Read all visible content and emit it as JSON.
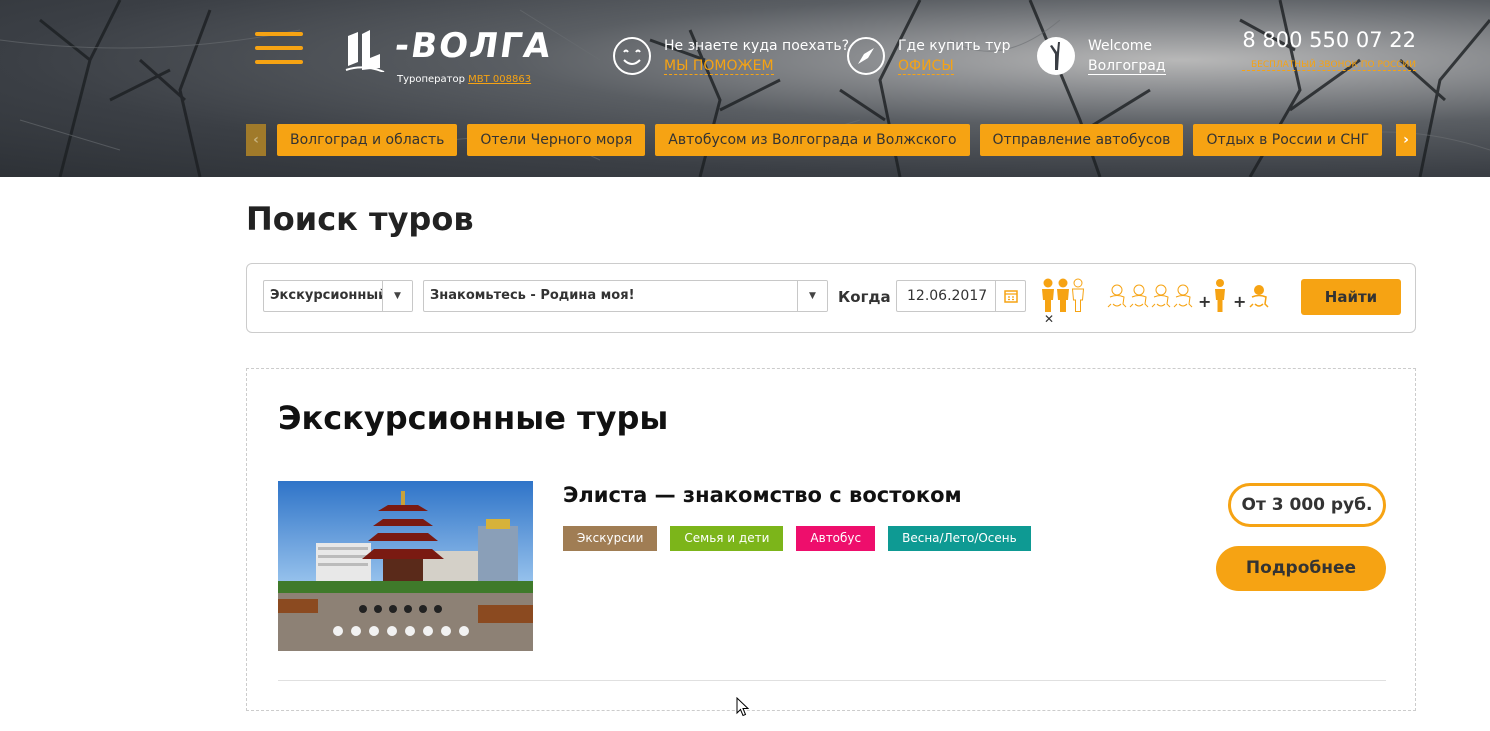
{
  "brand": {
    "logo_text": "В-ВОЛГА",
    "operator_prefix": "Туроператор",
    "operator_id": "МВТ 008863"
  },
  "header": {
    "help": {
      "line1": "Не знаете куда поехать?",
      "line2": "МЫ ПОМОЖЕМ",
      "icon": "smile-icon"
    },
    "offices": {
      "line1": "Где купить тур",
      "line2": "ОФИСЫ",
      "icon": "compass-icon"
    },
    "city": {
      "line1": "Welcome",
      "line2": "Волгоград",
      "icon": "monument-icon"
    },
    "phone": {
      "number": "8 800 550 07 22",
      "note": "БЕСПЛАТНЫЙ ЗВОНОК ПО РОССИИ"
    }
  },
  "categories": [
    "Волгоград и область",
    "Отели Черного моря",
    "Автобусом из Волгограда и Волжского",
    "Отправление автобусов",
    "Отдых в России и СНГ"
  ],
  "search": {
    "title": "Поиск туров",
    "type_value": "Экскурсионный.",
    "tour_value": "Знакомьтесь - Родина моя!",
    "when_label": "Когда",
    "date_value": "12.06.2017",
    "adults_selected": 2,
    "adults_max": 3,
    "children_slots": 4,
    "find_label": "Найти"
  },
  "results": {
    "title": "Экскурсионные туры",
    "tour": {
      "name": "Элиста — знакомство с востоком",
      "price": "От 3 000 руб.",
      "more_label": "Подробнее",
      "tags": [
        {
          "label": "Экскурсии",
          "color": "#a07d54"
        },
        {
          "label": "Семья и дети",
          "color": "#7cb51a"
        },
        {
          "label": "Автобус",
          "color": "#ee0e6c"
        },
        {
          "label": "Весна/Лето/Осень",
          "color": "#0e9a93"
        }
      ]
    }
  },
  "colors": {
    "accent": "#f6a313"
  }
}
